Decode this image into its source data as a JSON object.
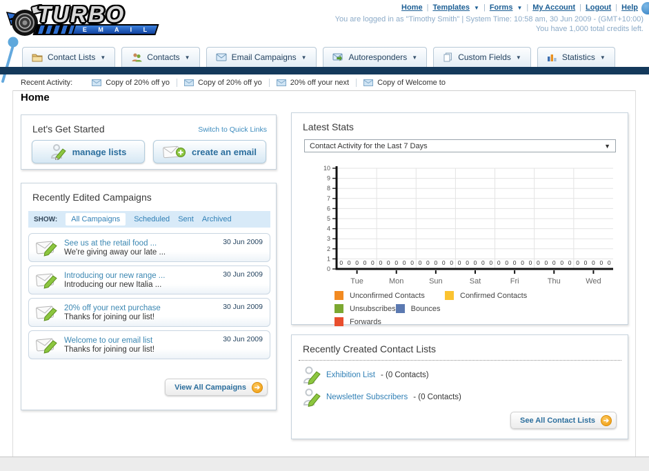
{
  "header": {
    "logo_line1": "TURBO",
    "logo_line2": "E M A I L",
    "nav": {
      "home": "Home",
      "templates": "Templates",
      "forms": "Forms",
      "my_account": "My Account",
      "logout": "Logout",
      "help": "Help"
    },
    "login_info": "You are logged in as \"Timothy Smith\" | System Time: 10:58 am, 30 Jun 2009 - (GMT+10:00)",
    "credits_info": "You have 1,000 total credits left."
  },
  "tabs": [
    {
      "label": "Contact Lists",
      "icon": "folder-icon"
    },
    {
      "label": "Contacts",
      "icon": "people-icon"
    },
    {
      "label": "Email Campaigns",
      "icon": "envelope-icon"
    },
    {
      "label": "Autoresponders",
      "icon": "envelope-arrow-icon"
    },
    {
      "label": "Custom Fields",
      "icon": "pages-icon"
    },
    {
      "label": "Statistics",
      "icon": "bar-chart-icon"
    }
  ],
  "recent_activity": {
    "label": "Recent Activity:",
    "items": [
      "Copy of 20% off yo",
      "Copy of 20% off yo",
      "20% off your next",
      "Copy of Welcome to"
    ]
  },
  "page_title": "Home",
  "get_started": {
    "title": "Let's Get Started",
    "switch_link": "Switch to Quick Links",
    "manage_lists_label": "manage lists",
    "create_email_label": "create an email"
  },
  "campaigns": {
    "title": "Recently Edited Campaigns",
    "show_label": "SHOW:",
    "filters": [
      "All Campaigns",
      "Scheduled",
      "Sent",
      "Archived"
    ],
    "active_filter": "All Campaigns",
    "items": [
      {
        "title": "See us at the retail food ...",
        "subtitle": "We're giving away our late ...",
        "date": "30 Jun 2009"
      },
      {
        "title": "Introducing our new range ...",
        "subtitle": "Introducing our new Italia ...",
        "date": "30 Jun 2009"
      },
      {
        "title": "20% off your next purchase",
        "subtitle": "Thanks for joining our list!",
        "date": "30 Jun 2009"
      },
      {
        "title": "Welcome to our email list",
        "subtitle": "Thanks for joining our list!",
        "date": "30 Jun 2009"
      }
    ],
    "view_all_label": "View All Campaigns"
  },
  "stats": {
    "title": "Latest Stats",
    "dropdown_value": "Contact Activity for the Last 7 Days"
  },
  "chart_data": {
    "type": "bar",
    "title": "Contact Activity for the Last 7 Days",
    "categories": [
      "Tue",
      "Mon",
      "Sun",
      "Sat",
      "Fri",
      "Thu",
      "Wed"
    ],
    "series": [
      {
        "name": "Unconfirmed Contacts",
        "color": "#F28A21",
        "values": [
          0,
          0,
          0,
          0,
          0,
          0,
          0
        ]
      },
      {
        "name": "Confirmed Contacts",
        "color": "#FBC330",
        "values": [
          0,
          0,
          0,
          0,
          0,
          0,
          0
        ]
      },
      {
        "name": "Unsubscribes",
        "color": "#7CA831",
        "values": [
          0,
          0,
          0,
          0,
          0,
          0,
          0
        ]
      },
      {
        "name": "Bounces",
        "color": "#5B79B1",
        "values": [
          0,
          0,
          0,
          0,
          0,
          0,
          0
        ]
      },
      {
        "name": "Forwards",
        "color": "#E84E2D",
        "values": [
          0,
          0,
          0,
          0,
          0,
          0,
          0
        ]
      }
    ],
    "ylim": [
      0,
      10
    ],
    "ytick_step": 1,
    "grid": true,
    "legend_position": "bottom",
    "point_label": "0"
  },
  "contact_lists": {
    "title": "Recently Created Contact Lists",
    "items": [
      {
        "name": "Exhibition List",
        "detail": "- (0 Contacts)"
      },
      {
        "name": "Newsletter Subscribers",
        "detail": "- (0 Contacts)"
      }
    ],
    "see_all_label": "See All Contact Lists"
  },
  "colors": {
    "navy_bar": "#14395B",
    "link_blue": "#2F7FB5",
    "accent_orange": "#F0A01E"
  }
}
